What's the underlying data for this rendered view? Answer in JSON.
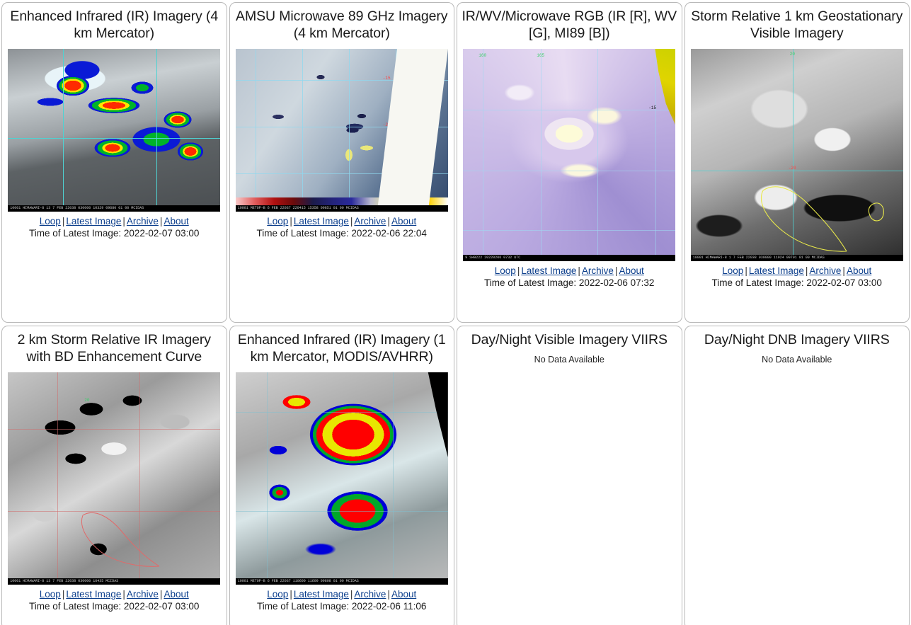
{
  "links": {
    "loop": "Loop",
    "latest": "Latest Image",
    "archive": "Archive",
    "about": "About",
    "separator": "|"
  },
  "time_prefix": "Time of Latest Image: ",
  "panels": [
    {
      "title": "Enhanced Infrared (IR) Imagery (4 km Mercator)",
      "time_label": "Time of Latest Image: 2022-02-07 03:00",
      "timestamp": "2022-02-07 03:00",
      "has_image": true,
      "image_caption": "10001 HIMAWARI-8 13  7 FEB 22038 030000 10329 09680 01 00   MCIDAS",
      "no_data": null
    },
    {
      "title": "AMSU Microwave 89 GHz Imagery (4 km Mercator)",
      "time_label": "Time of Latest Image: 2022-02-06 22:04",
      "timestamp": "2022-02-06 22:04",
      "has_image": true,
      "image_caption": "10001 METOP-B  6 FEB 22037 220415 15358 09851 01 00   MCIDAS",
      "no_data": null,
      "grid_labels": [
        "-15",
        "-20",
        "-25"
      ]
    },
    {
      "title": "IR/WV/Microwave RGB (IR [R], WV [G], MI89 [B])",
      "time_label": "Time of Latest Image: 2022-02-06 07:32",
      "timestamp": "2022-02-06 07:32",
      "has_image": true,
      "image_caption": "9   SH9222  20220206  0732  UTC",
      "no_data": null,
      "grid_labels": [
        "160",
        "165",
        "-15"
      ]
    },
    {
      "title": "Storm Relative 1 km Geostationary Visible Imagery",
      "time_label": "Time of Latest Image: 2022-02-07 03:00",
      "timestamp": "2022-02-07 03:00",
      "has_image": true,
      "image_caption": "10001 HIMAWARI-8  1  7 FEB 22038 030000 11924 09701 01 00  MCIDAS",
      "no_data": null,
      "grid_labels": [
        "-20"
      ]
    },
    {
      "title": "2 km Storm Relative IR Imagery with BD Enhancement Curve",
      "time_label": "Time of Latest Image: 2022-02-07 03:00",
      "timestamp": "2022-02-07 03:00",
      "has_image": true,
      "image_caption": "10001 HIMAWARI-8 13  7 FEB 22038 030000 16435 MCIDAS",
      "no_data": null
    },
    {
      "title": "Enhanced Infrared (IR) Imagery (1 km Mercator, MODIS/AVHRR)",
      "time_label": "Time of Latest Image: 2022-02-06 11:06",
      "timestamp": "2022-02-06 11:06",
      "has_image": true,
      "image_caption": "10001 METOP-B   6 FEB 22037 110600 11609 09808 01 00   MCIDAS",
      "no_data": null
    },
    {
      "title": "Day/Night Visible Imagery VIIRS",
      "time_label": null,
      "timestamp": null,
      "has_image": false,
      "image_caption": null,
      "no_data": "No Data Available"
    },
    {
      "title": "Day/Night DNB Imagery VIIRS",
      "time_label": null,
      "timestamp": null,
      "has_image": false,
      "image_caption": null,
      "no_data": "No Data Available"
    }
  ]
}
